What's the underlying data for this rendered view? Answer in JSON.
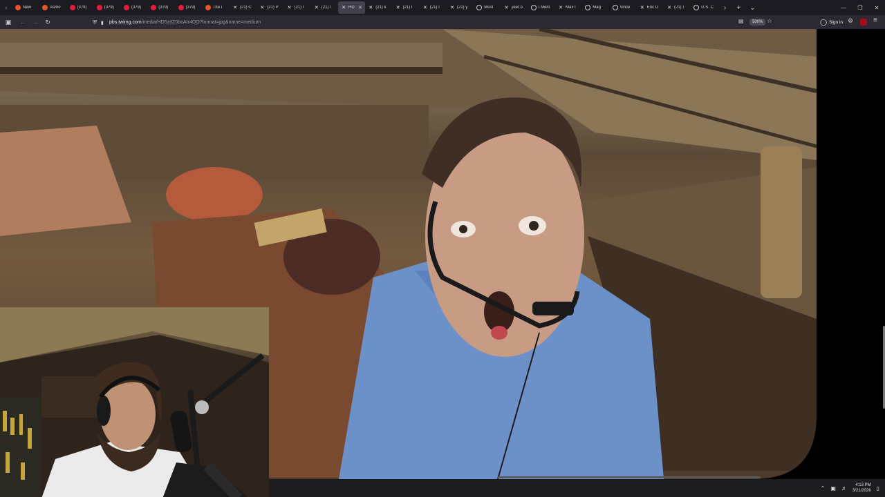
{
  "tabs": [
    {
      "label": "New",
      "favicon": "reddit-alien-icon",
      "active": false
    },
    {
      "label": "Asmo",
      "favicon": "reddit-alien-icon",
      "active": false
    },
    {
      "label": "(379)",
      "favicon": "youtube-icon",
      "active": false
    },
    {
      "label": "(379)",
      "favicon": "youtube-icon",
      "active": false
    },
    {
      "label": "(379)",
      "favicon": "youtube-icon",
      "active": false
    },
    {
      "label": "(379)",
      "favicon": "youtube-icon",
      "active": false
    },
    {
      "label": "(379)",
      "favicon": "youtube-icon",
      "active": false
    },
    {
      "label": "The i",
      "favicon": "reddit-alien-icon",
      "active": false
    },
    {
      "label": "(21) C",
      "favicon": "x-logo-icon",
      "active": false
    },
    {
      "label": "(21) P",
      "favicon": "x-logo-icon",
      "active": false
    },
    {
      "label": "(21) I",
      "favicon": "x-logo-icon",
      "active": false
    },
    {
      "label": "(21) I",
      "favicon": "x-logo-icon",
      "active": false
    },
    {
      "label": "HD",
      "favicon": "x-logo-icon",
      "active": true
    },
    {
      "label": "(21) k",
      "favicon": "x-logo-icon",
      "active": false
    },
    {
      "label": "(21) I",
      "favicon": "x-logo-icon",
      "active": false
    },
    {
      "label": "(21) I",
      "favicon": "x-logo-icon",
      "active": false
    },
    {
      "label": "(21) y",
      "favicon": "x-logo-icon",
      "active": false
    },
    {
      "label": "Most",
      "favicon": "globe-icon",
      "active": false
    },
    {
      "label": "yeet o",
      "favicon": "x-logo-icon",
      "active": false
    },
    {
      "label": "I Mem",
      "favicon": "globe-icon",
      "active": false
    },
    {
      "label": "Max I",
      "favicon": "x-logo-icon",
      "active": false
    },
    {
      "label": "Mag",
      "favicon": "globe-icon",
      "active": false
    },
    {
      "label": "Vince",
      "favicon": "globe-icon",
      "active": false
    },
    {
      "label": "Eric D",
      "favicon": "x-logo-icon",
      "active": false
    },
    {
      "label": "(21) I",
      "favicon": "x-logo-icon",
      "active": false
    },
    {
      "label": "U.S. C",
      "favicon": "globe-icon",
      "active": false
    }
  ],
  "toolbar": {
    "url_host": "pbs.twimg.com",
    "url_path": "/media/HD5zdZ0boAIr4OO?format=jpg&name=medium",
    "zoom": "500%",
    "signin_label": "Sign in"
  },
  "taskbar": {
    "time": "4:13 PM",
    "date": "3/21/2026"
  }
}
